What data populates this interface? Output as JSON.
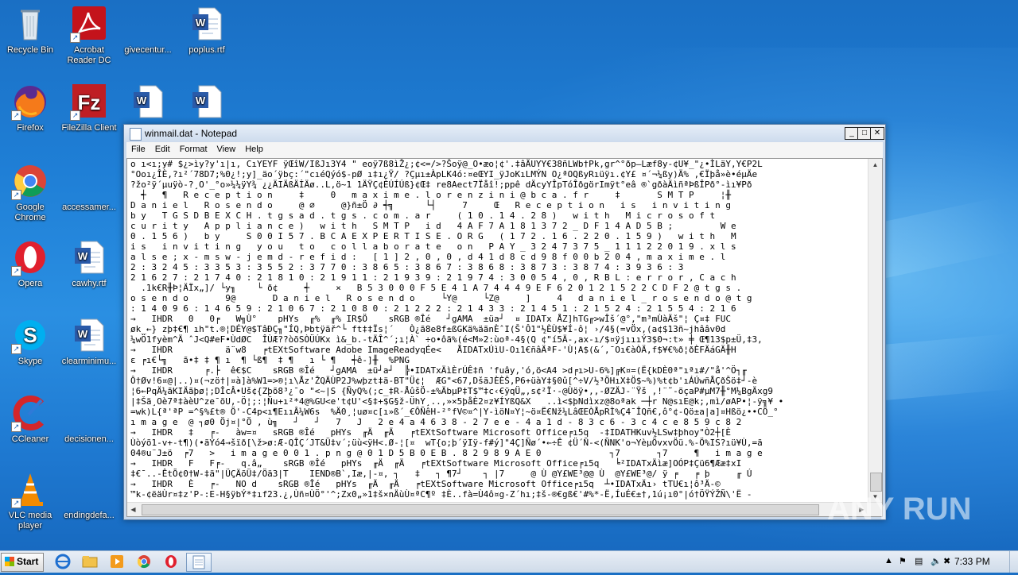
{
  "desktop": {
    "icons": [
      {
        "label": "Recycle Bin"
      },
      {
        "label": "Acrobat Reader DC"
      },
      {
        "label": "givecentur..."
      },
      {
        "label": "poplus.rtf"
      },
      {
        "label": "Firefox"
      },
      {
        "label": "FileZilla Client"
      },
      {
        "label": "Google Chrome"
      },
      {
        "label": "accessamer..."
      },
      {
        "label": "Opera"
      },
      {
        "label": "cawhy.rtf"
      },
      {
        "label": "Skype"
      },
      {
        "label": "clearminimu..."
      },
      {
        "label": "CCleaner"
      },
      {
        "label": "decisionen..."
      },
      {
        "label": "VLC media player"
      },
      {
        "label": "endingdefa..."
      }
    ]
  },
  "notepad": {
    "title": "winmail.dat - Notepad",
    "menu": [
      "File",
      "Edit",
      "Format",
      "View",
      "Help"
    ],
    "lines": [
      "o ı<ı;y# $¿>ìy?y'ı|ı, CıYEYF ÿŒîW/IßJı3Y4 \" eoÿ7ß8ìŽ¿;¢<=/>?Šoÿ@_O•æo¦¢'.‡âÄUYY€38ñLWb†Pk,gr^°ðp–Læf8y-¢U¥_\"¿•ÌLäY,Y€P2L",
      "°Ooı¿ÎÈ,?ı²´78D7;%0¿!;y]_äo´ÿbç:´\"cıéQýó$-pØ ı‡ı¿Ÿ/ ?Çµı±ÀpLK4ó:¤eŒYI_ÿJoKıLMÝN O¿ªOQßyRıüÿı.¢Y£ ¤´¬¼ßy)Ä% ,€Ïþå»è•éµÄe",
      "?žo²ÿ´µuÿò-?¸O'_°o»¼¼ÿY¾ ¿¿ÄIÄßÄİÄø..L,ö~1 1ÄŸÇ¢ÈÚÍÚß}¢Œ‡ re8Aect7Ïåî!;ppê dÄcyYÎpTóÎðgörImÿt°eâ ®`gðàÄìñªÞßÎPð°-ìı¥Pð",
      "  ┽   ¶   R e c e p t i o n     ‡     0   m a x i m e . l o r e n z i n i @ b c a . f r     ‡       S M T P     ¦╫",
      "D a n i e l   R o s e n d o     @ ∅     @}ñ±Ö ∂ ┽╗      └┤     7     Œ   R e c e p t i o n   i s   i n v i t i n g",
      "b y   T G S D B E X C H . t g s a d . t g s . c o m . a r     ( 1 0 . 1 4 . 2 8 )   w i t h   M i c r o s o f t",
      "c u r i t y   A p p l i a n c e )   w i t h   S M T P   i d   4 A F 7 A 1 8 1 3 7 2 _ D F 1 4 A D 5 B ;         W e",
      "0 . 1 5 6 )   b y     S 0 0 I 5 7 . B C A E X P E R T I S E . O R G   ( 1 7 2 . 1 6 . 2 2 0 . 1 5 9 )   w i t h   M",
      "i s   i n v i t i n g   y o u   t o   c o l l a b o r a t e   o n   P A Y _ 3 2 4 7 3 7 5 _ 1 1 1 2 2 0 1 9 . x l s",
      "a l s e ; x - m s w - j e m d - r e f i d :   [ 1 ] 2 , 0 , 0 , d 4 1 d 8 c d 9 8 f 0 0 b 2 0 4 , m a x i m e . l",
      "2 : 3 2 4 5 : 3 3 5 3 : 3 5 5 2 : 3 7 7 0 : 3 8 6 5 : 3 8 6 7 : 3 8 6 8 : 3 8 7 3 : 3 8 7 4 : 3 9 3 6 : 3",
      "2 1 6 2 7 : 2 1 7 4 0 : 2 1 8 1 0 : 2 1 9 1 1 : 2 1 9 3 9 : 2 1 9 7 4 : 3 0 0 5 4 , 0 , R B L : e r r o r , C a c h",
      "  .1k€R╫Þ¦ÄÏx„]/ └y╖    └ ð¢     ┽     ×   B 5 3 0 0 0 F 5 E 4 1 A 7 4 4 4 9 E F 6 2 0 1 2 1 5 2 2 C D F 2 @ t g s .",
      "o s e n d o       9@       D a n i e l   R o s e n d o     └Y@     └Z@     ]     4   d a n i e l _ r o s e n d o @ t g",
      ": 1 4 0 9 6 : 1 4 6 5 9 : 2 1 0 6 7 : 2 1 0 8 0 : 2 1 2 2 2 : 2 1 4 3 3 : 2 1 4 5 1 : 2 1 5 2 4 : 2 1 5 5 4 : 2 1 6",
      "→   IHDR   0   0╒   W╗Ù°    pHYs  ╓%  ╓% IR$Ö    sRGB ®Îé   ┘gAMA  ±üa┘  ¤ IDATx ÅZ]hTG╓>wÎš´@°,\"m³mÙàÄš\"¦ Ç¤‡ FUC",
      "øk_←} zþ‡€¶ ıh\"t.®¦DÉY@$TâÐÇ╖\"ÍQ,Þbtÿäř^└ ft‡‡Ïs¦´   Ò¿ã8e8f±ßGKä%äãnÈˆI(Š'Ô1\"½ÈÙ$¥Í-ô¦ ›/4§(=vÖx,(a¢$13ñ~jhââv0d",
      "¼wÖ1fyèm^Ä ˆJ<Q#eF•ÙdØC  ÎÙÆ??òõSÒÜÚKx ì&_b.-tÄÎ^´;ı¦À` ÷o•ôä%(é<M»2:ùoª-4§(Q ¢\"í5Ä-,ax-ı/$¤ÿjıııÝ3$0¬:t» ╪ Œ¶13$p±Ü,‡3,",
      "→   IHDR          ä¨w8   ╒tEXtSoftware Adobe ImageReadyqÉe<   ÅIDATxÚìU-Oı1€ñâÄªF-'Ù¦A$(&´,¯Oı€àÒÄ,f$¥€%ð¦ðÈFÄáGÄ╫H",
      "ε ╒ı€└╗   ã•‡ ‡ ¶ ı  ¶ └ß¶  ‡ ¶   ı └ ¶   ┽ê-]╫  %PNG",
      "→   IHDR      ╒.├  ê€$C    sRGB ®Îé   ┘gAMA  ±ü┘a┘  ╠•IDATxÄìÈrÚÊ‡ñ 'fuây,'ó,ö<A4 >d╒ı>U-6%]╔K¤=(Ë{kDÈ0ª\"ıªı#/\"å'^Ö┐╓",
      "Ô†Øv!6¤@|..)¤(¬zö†|¤à]à%W1=>®¦ı\\Åz'ŽQÄÙP2J%wþzt‡ä-BT\"Ü¢¦  ÆG\"<67,DšãJÈÈŠ,P6+üàY‡§0û[^÷V/½³ÖHıX‡Ö$~%)%t¢b'ıÁÚwñÅÇðŠö‡┘-è",
      "¦6←PqÄ¼ãKIÄãþø¦;DÎcÂ•Uš¢{Zþõ8³¿¯o \"<~|S {ÑyQ%(;c_‡R-ÅûšÖ-±%ÄbµP‡T$™‡c‹€ÿqÜ„,s¢²Ï·-@Ùöÿ•,,-ØZÄJ-¨Ÿš ,!¨˜-öçaP#µM7╫°M¼BgÄxg9",
      "|‡Šä¸Oè7ª‡àèU^ze¯õU,-Ö¦;:¦Ñu+ı²*4@%GU<e't¢U'<§‡+$G§ž-ÜhY¸..,»×5þåÈ2¤z¥ÍYßQ&X   ..ì<$þNdìxz@8oªak ─┼r N@sıE@k;,mì/øAP•¦-ÿ╗¥ •",
      "=wk)L{ª'ªP =^§%£t® Ö'-C4p<ı¶EııÂ¼W6s  %Ä0¸¦uø¤c[ı»ß´_€ÔÑêH-²°fV©¤^|Y-ìöN¤Y¦~ö¤Ë€Nž¼LâŒEÒÅpRÌ%Ç4¯ÎQñ€,ô°¢-Qö±a|a]¤Hßö¿••CÖ_°",
      "ı m a g e  @ ┐ø0 Öj¤|°Ö , ù╗   ┘   ┘   7   J   2 e 4 a 4 6 3 8 - 2 7 e e - 4 a 1 d - 8 3 c 6 - 3 c 4 c e 8 5 9 c 8 2",
      "→   IHDR   ‡   ╒-   àw=¤   sRGB ®Îé   pHYs  ╓Ä  ╓Ä   ╒tEXtSoftware Microsoft Office╒ı5q  -‡IDATHKuv½LSw‡þhoy\"Ò2┼[È",
      "Ùòýõ1-v+-t¶)(•ãÝó4→šïð[\\ž>ø:Æ-QÎÇ´JT&Ü‡v´;üù<ÿH<.Ø-¦[¤  wT{o;þ´ÿIÿ-f#ý]\"4Ç]Ñø´•←÷Ê ¢Ü´Ñ-<(ÑNK'o¬YèµÖvxvÖü.%-Ö%IS?ıü¥Ù,=ã",
      "04®u¨J±ö  ╒7   >   i m a g e 0 0 1 . p n g @ 0 1 D 5 B 0 E B . 8 2 9 8 9 A E 0             ┐7       ┐7     ¶   i m a g e",
      "→   IHDR   F   F╒-   q.â„    sRGB ®Îé   pHYs  ╓Ä  ╓Ä   ╒tEXtSoftware Microsoft Office╒ı5q   ╘²IDATxÄìæ]OÓP‡Çü6¶Ææ‡xI",
      "‡€¯..-ÊtÕ¢0†W-‡ä\"|ÜÇÄõÜ‡/Öä3|T    IEND®B`,Iæ,|-¤, ┐   ‡   ┐ ¶7┘    ┐ |7     @ Ù @Y£WE³@@ Ù  @Y£WE³@/ ÿ ╒   ╒ þ     ╓ Ú",
      "→   IHDR   È   ╒-   NO d    sRGB ®Îé   pHYs  ╓Ä  ╓Ä   ╒tEXtSoftware Microsoft Office╒ı5q  ┴•IDATxÄı› tTU€ı¦ô³Ä-©",
      "™k-¢ëäÙr¤‡z'P-:E-H§ÿbÝ*‡ıf23.¿‚Ùñ¤ÙÖ°'^;Zx0„»1‡š×nÄùÙ¤ªC¶º ‡È..fà=Ù4ô¤g-Z´hı;‡š-®€gß€'#%*-Ë,ÍuÉ€±†,1ú¡ı0°|ó†ÖŸÝŽÑ\\'Ë -"
    ]
  },
  "taskbar": {
    "start_label": "Start",
    "clock": "7:33 PM"
  },
  "watermark": {
    "text": "ANY RUN"
  }
}
